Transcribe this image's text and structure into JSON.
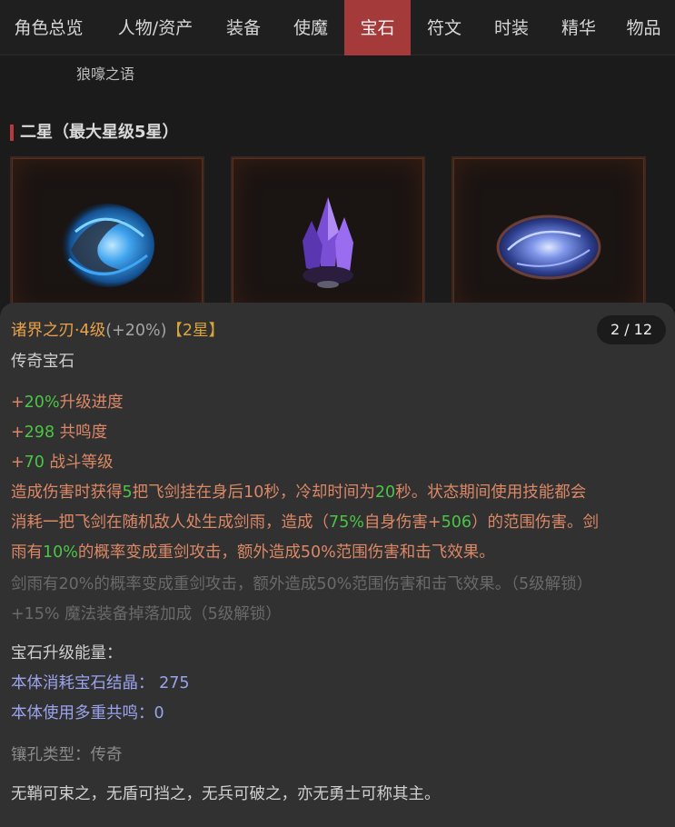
{
  "tabs": [
    {
      "label": "角色总览",
      "active": false
    },
    {
      "label": "人物/资产",
      "active": false
    },
    {
      "label": "装备",
      "active": false
    },
    {
      "label": "使魔",
      "active": false
    },
    {
      "label": "宝石",
      "active": true
    },
    {
      "label": "符文",
      "active": false
    },
    {
      "label": "时装",
      "active": false
    },
    {
      "label": "精华",
      "active": false
    },
    {
      "label": "物品",
      "active": false
    }
  ],
  "sub_label": "狼嚎之语",
  "section_title": "二星（最大星级5星）",
  "cards": [
    {
      "gem": "blue-swirl-orb-gem"
    },
    {
      "gem": "purple-crystal-gem"
    },
    {
      "gem": "blue-vortex-disc-gem"
    }
  ],
  "detail": {
    "pager": "2 / 12",
    "name": "诸界之刃·4级",
    "bonus": "(+20%)",
    "stars": "【2星】",
    "type": "传奇宝石",
    "stats": [
      {
        "prefix": "+",
        "value": "20%",
        "label": "升级进度"
      },
      {
        "prefix": "+",
        "value": "298",
        "label": " 共鸣度"
      },
      {
        "prefix": "+",
        "value": "70",
        "label": " 战斗等级"
      }
    ],
    "effect": {
      "l1_a": "造成伤害时获得",
      "l1_v1": "5",
      "l1_b": "把飞剑挂在身后10秒，冷却时间为",
      "l1_v2": "20",
      "l1_c": "秒。状态期间使用技能都会",
      "l2_a": "消耗一把飞剑在随机敌人处生成剑雨，造成（",
      "l2_v1": "75%",
      "l2_b": "自身伤害+",
      "l2_v2": "506",
      "l2_c": "）的范围伤害。剑",
      "l3_a": "雨有",
      "l3_v1": "10%",
      "l3_b": "的概率变成重剑攻击，额外造成50%范围伤害和击飞效果。"
    },
    "locked": [
      "剑雨有20%的概率变成重剑攻击，额外造成50%范围伤害和击飞效果。（5级解锁）",
      "+15% 魔法装备掉落加成（5级解锁）"
    ],
    "energy_title": "宝石升级能量：",
    "energy_lines": [
      {
        "label": "本体消耗宝石结晶：",
        "value": " 275"
      },
      {
        "label": "本体使用多重共鸣：",
        "value": "0"
      }
    ],
    "socket": "镶孔类型：传奇",
    "lore": "无鞘可束之，无盾可挡之，无兵可破之，亦无勇士可称其主。"
  }
}
